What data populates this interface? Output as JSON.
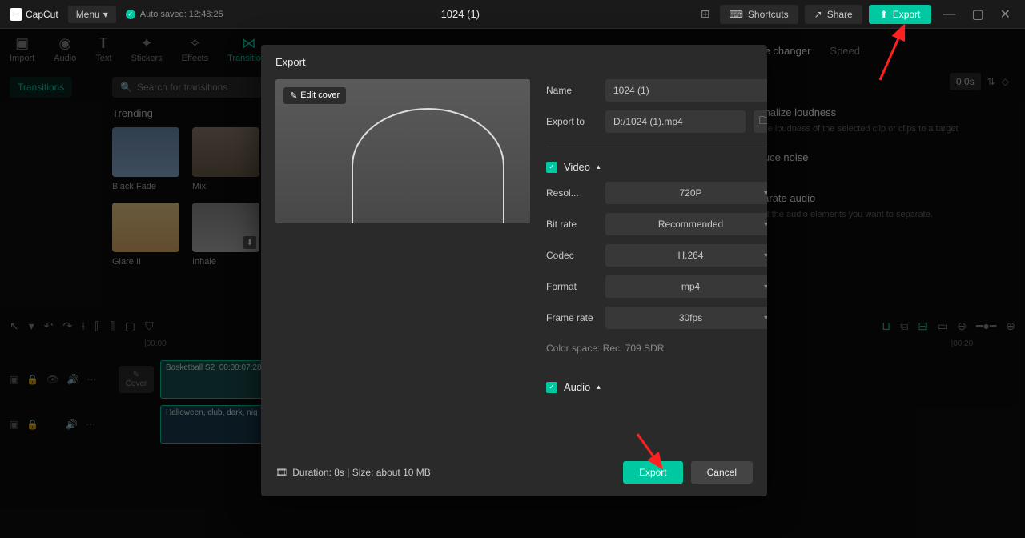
{
  "titlebar": {
    "logo": "CapCut",
    "menu": "Menu",
    "autosave": "Auto saved: 12:48:25",
    "project_title": "1024 (1)",
    "shortcuts": "Shortcuts",
    "share": "Share",
    "export": "Export"
  },
  "tools": {
    "import": "Import",
    "audio": "Audio",
    "text": "Text",
    "stickers": "Stickers",
    "effects": "Effects",
    "transitions": "Transitions"
  },
  "sidebar": {
    "transitions": "Transitions"
  },
  "gallery": {
    "search_placeholder": "Search for transitions",
    "heading": "Trending",
    "items": [
      {
        "label": "Black Fade"
      },
      {
        "label": "Mix"
      },
      {
        "label": "Glare II"
      },
      {
        "label": "Inhale"
      }
    ]
  },
  "right": {
    "tabs": {
      "voice": "Voice changer",
      "speed": "Speed"
    },
    "duration": "0.0s",
    "normalize_title": "Normalize loudness",
    "normalize_desc": "Set the loudness of the selected clip or clips to a target",
    "reduce_title": "Reduce noise",
    "separate_title": "Separate audio",
    "separate_desc": "Select the audio elements you want to separate."
  },
  "timeline": {
    "t0": "|00:00",
    "t20": "|00:20",
    "clip1_name": "Basketball S2",
    "clip1_time": "00:00:07:28",
    "clip2_name": "Halloween, club, dark, nig",
    "cover": "Cover"
  },
  "modal": {
    "title": "Export",
    "edit_cover": "Edit cover",
    "name_label": "Name",
    "name_value": "1024 (1)",
    "exportto_label": "Export to",
    "exportto_value": "D:/1024 (1).mp4",
    "video_section": "Video",
    "resolution_label": "Resol...",
    "resolution_value": "720P",
    "bitrate_label": "Bit rate",
    "bitrate_value": "Recommended",
    "codec_label": "Codec",
    "codec_value": "H.264",
    "format_label": "Format",
    "format_value": "mp4",
    "framerate_label": "Frame rate",
    "framerate_value": "30fps",
    "colorspace": "Color space: Rec. 709 SDR",
    "audio_section": "Audio",
    "footer_info": "Duration: 8s | Size: about 10 MB",
    "export_btn": "Export",
    "cancel_btn": "Cancel"
  }
}
